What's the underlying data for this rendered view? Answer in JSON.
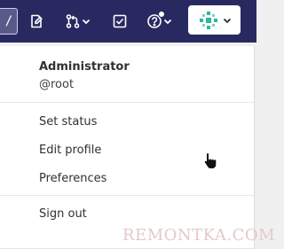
{
  "topbar": {
    "search_shortcut": "/",
    "icons": [
      "search-icon",
      "issues-icon",
      "merge-request-icon",
      "todo-checkbox-icon",
      "help-icon",
      "avatar-icon"
    ],
    "colors": {
      "background": "#292961",
      "icon": "#ffffff",
      "avatar_bg": "#ffffff",
      "avatar_accent": "#2fb6a0"
    }
  },
  "user_menu": {
    "name": "Administrator",
    "username": "@root",
    "items": [
      {
        "label": "Set status"
      },
      {
        "label": "Edit profile"
      },
      {
        "label": "Preferences"
      }
    ],
    "sign_out": "Sign out"
  },
  "watermark": "REMONTKA.COM"
}
